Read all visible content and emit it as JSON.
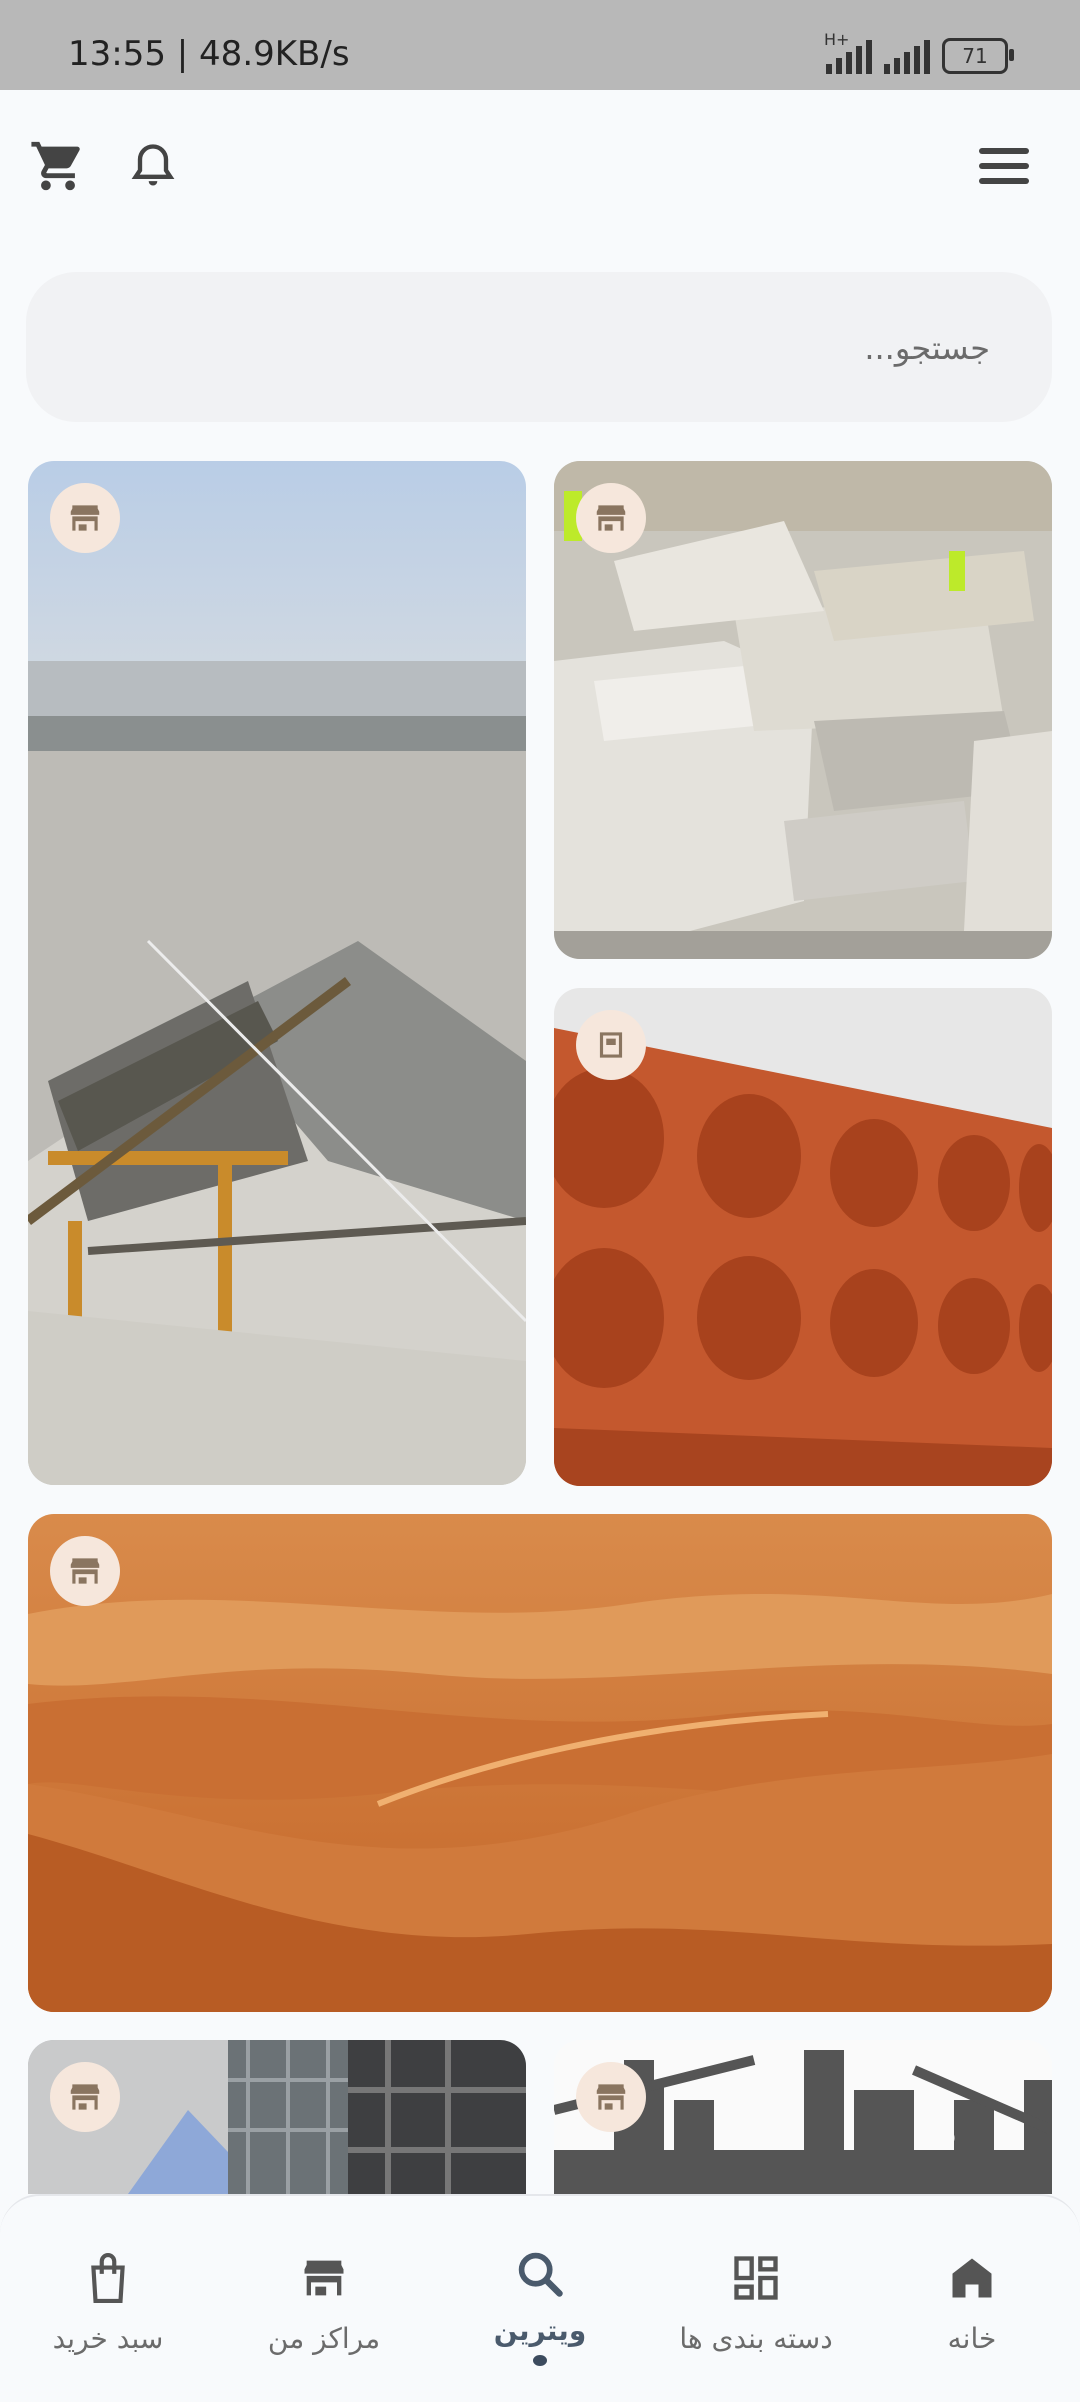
{
  "status_bar": {
    "time_speed": "13:55 | 48.9KB/s",
    "network": "H+",
    "battery": "71"
  },
  "header": {
    "icons": [
      "cart-icon",
      "bell-icon",
      "menu-icon"
    ]
  },
  "search": {
    "placeholder": "جستجو..."
  },
  "tiles": [
    {
      "subject": "crushing-machine",
      "icon": "store-icon"
    },
    {
      "subject": "marble-blocks",
      "icon": "store-icon"
    },
    {
      "subject": "perforated-brick",
      "icon": "store-icon"
    },
    {
      "subject": "sand-dunes",
      "icon": "store-icon"
    },
    {
      "subject": "building-scaffolding",
      "icon": "store-icon"
    },
    {
      "subject": "city-construction",
      "icon": "store-icon"
    }
  ],
  "bottom_nav": {
    "items": [
      {
        "label": "سبد خرید",
        "icon": "shopping-bag-icon"
      },
      {
        "label": "مراکز من",
        "icon": "store-icon"
      },
      {
        "label": "ویترین",
        "icon": "search-icon",
        "active": true
      },
      {
        "label": "دسته بندی ها",
        "icon": "dashboard-icon"
      },
      {
        "label": "خانه",
        "icon": "home-icon"
      }
    ]
  },
  "colors": {
    "accent": "#3c4b5e",
    "badge_bg": "#f6e7dc",
    "icon": "#555555"
  }
}
